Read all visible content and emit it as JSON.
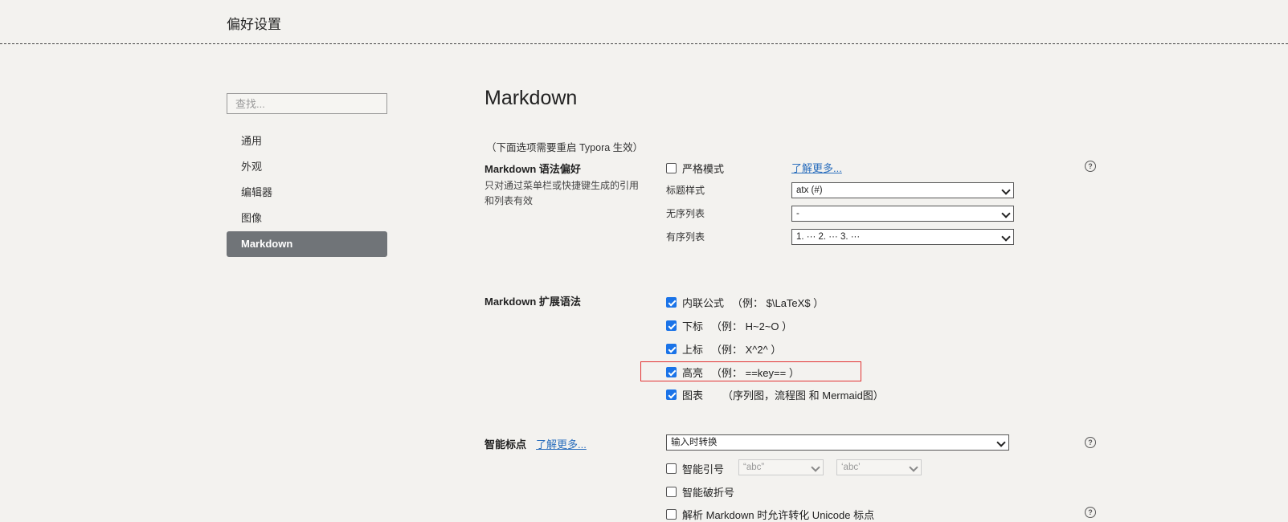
{
  "window": {
    "title": "偏好设置"
  },
  "sidebar": {
    "search_placeholder": "查找...",
    "items": [
      {
        "label": "通用"
      },
      {
        "label": "外观"
      },
      {
        "label": "编辑器"
      },
      {
        "label": "图像"
      },
      {
        "label": "Markdown",
        "active": true
      }
    ]
  },
  "main": {
    "title": "Markdown",
    "restart_note": "（下面选项需要重启 Typora 生效）",
    "syntax": {
      "heading": "Markdown 语法偏好",
      "description": "只对通过菜单栏或快捷键生成的引用和列表有效",
      "strict_mode": {
        "label": "严格模式",
        "checked": false
      },
      "learn_more": "了解更多...",
      "heading_style": {
        "label": "标题样式",
        "value": "atx (#)"
      },
      "unordered_list": {
        "label": "无序列表",
        "value": "-"
      },
      "ordered_list": {
        "label": "有序列表",
        "value": "1. ··· 2. ··· 3. ···"
      }
    },
    "extensions": {
      "heading": "Markdown 扩展语法",
      "items": [
        {
          "label": "内联公式",
          "example": "（例： $\\LaTeX$ ）",
          "checked": true
        },
        {
          "label": "下标",
          "example": "（例： H~2~O ）",
          "checked": true
        },
        {
          "label": "上标",
          "example": "（例： X^2^ ）",
          "checked": true
        },
        {
          "label": "高亮",
          "example": "（例： ==key== ）",
          "checked": true
        },
        {
          "label": "图表",
          "example": "（序列图，流程图 和 Mermaid图）",
          "checked": true
        }
      ]
    },
    "smart_punct": {
      "heading": "智能标点",
      "learn_more": "了解更多...",
      "mode": "输入时转换",
      "smart_quotes": {
        "label": "智能引号",
        "checked": false,
        "double": "“abc”",
        "single": "‘abc’"
      },
      "smart_dash": {
        "label": "智能破折号",
        "checked": false
      },
      "unicode": {
        "label": "解析 Markdown 时允许转化 Unicode 标点",
        "checked": false
      }
    },
    "help_glyph": "?"
  },
  "colors": {
    "background": "#f3f2ef",
    "active_nav": "#707478",
    "checkbox": "#1a73e8",
    "link": "#2a6ebd",
    "highlight_box": "#e23232"
  }
}
